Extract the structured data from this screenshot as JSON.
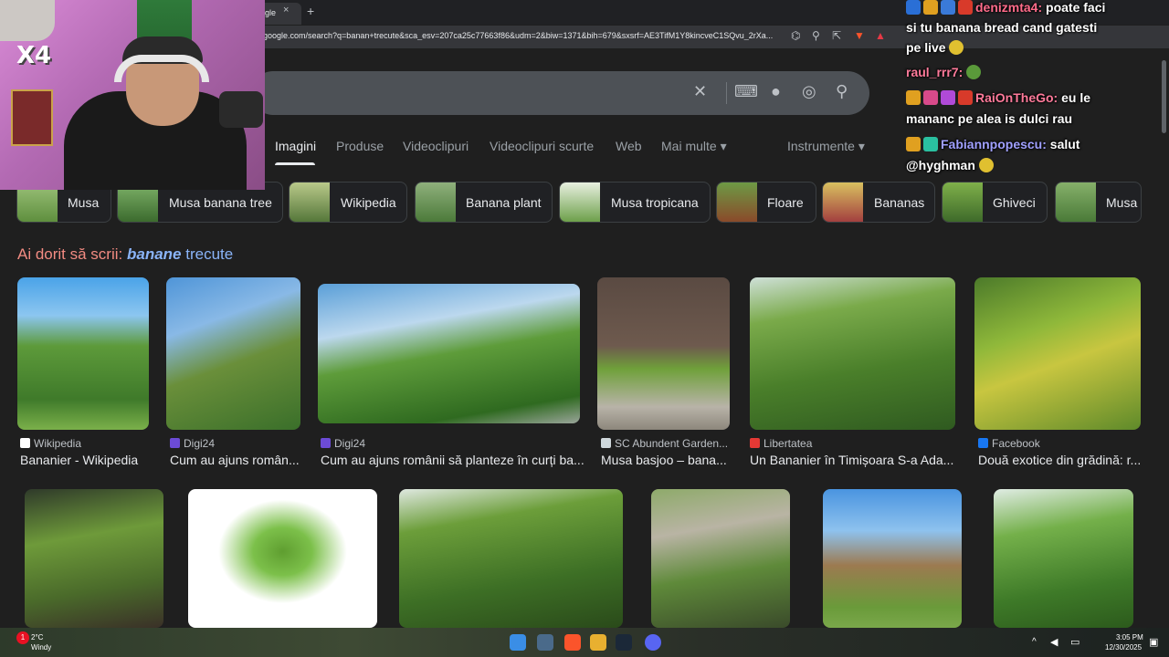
{
  "browser": {
    "tab_title": "gle",
    "tab_close": "×",
    "new_tab": "+",
    "url": "google.com/search?q=banan+trecute&sca_esv=207ca25c77663f86&udm=2&biw=1371&bih=679&sxsrf=AE3TifM1Y8kincveC1SQvu_2rXa..."
  },
  "search": {
    "clear_icon": "close-icon",
    "keyboard_icon": "keyboard-icon",
    "mic_icon": "mic-icon",
    "lens_icon": "lens-icon",
    "search_icon": "search-icon"
  },
  "nav_tabs": [
    {
      "label": "Imagini",
      "active": true
    },
    {
      "label": "Produse"
    },
    {
      "label": "Videoclipuri"
    },
    {
      "label": "Videoclipuri scurte"
    },
    {
      "label": "Web"
    },
    {
      "label": "Mai multe ▾"
    }
  ],
  "tools_label": "Instrumente ▾",
  "chips": [
    {
      "label": "Musa"
    },
    {
      "label": "Musa banana tree"
    },
    {
      "label": "Wikipedia"
    },
    {
      "label": "Banana plant"
    },
    {
      "label": "Musa tropicana"
    },
    {
      "label": "Floare"
    },
    {
      "label": "Bananas"
    },
    {
      "label": "Ghiveci"
    },
    {
      "label": "Musa"
    }
  ],
  "did_you_mean": {
    "prefix": "Ai dorit să scrii: ",
    "bold": "banane",
    "rest": " trecute"
  },
  "results_row1": [
    {
      "source": "Wikipedia",
      "caption": "Bananier - Wikipedia",
      "fav_color": "#ffffff"
    },
    {
      "source": "Digi24",
      "caption": "Cum au ajuns român...",
      "fav_color": "#6c4bd6"
    },
    {
      "source": "Digi24",
      "caption": "Cum au ajuns românii să planteze în curți ba...",
      "fav_color": "#6c4bd6"
    },
    {
      "source": "SC Abundent Garden...",
      "caption": "Musa basjoo – bana...",
      "fav_color": "#cfd8dc"
    },
    {
      "source": "Libertatea",
      "caption": "Un Bananier în Timișoara S-a Ada...",
      "fav_color": "#e53935"
    },
    {
      "source": "Facebook",
      "caption": "Două exotice din grădină: r...",
      "fav_color": "#1877f2"
    }
  ],
  "chat": {
    "line1_name": "denizmta4:",
    "line1_msg": " poate faci",
    "line2": "si tu banana bread cand gatesti",
    "line3": "pe live",
    "line4_name": "raul_rrr7:",
    "line5_name": "RaiOnTheGo:",
    "line5_msg": " eu le",
    "line6": "mananc pe alea is dulci rau",
    "line7_name": "Fabiannpopescu:",
    "line7_msg": " salut",
    "line8": "@hyghman"
  },
  "webcam": {
    "badge": "X4"
  },
  "taskbar": {
    "weather_temp": "2°C",
    "weather_desc": "Windy",
    "time": "3:05 PM",
    "date": "12/30/2025",
    "notif": "1"
  },
  "colors": {
    "background": "#1f1f1f",
    "accent_link": "#8ab4f8",
    "did_you_mean": "#f28b82"
  }
}
